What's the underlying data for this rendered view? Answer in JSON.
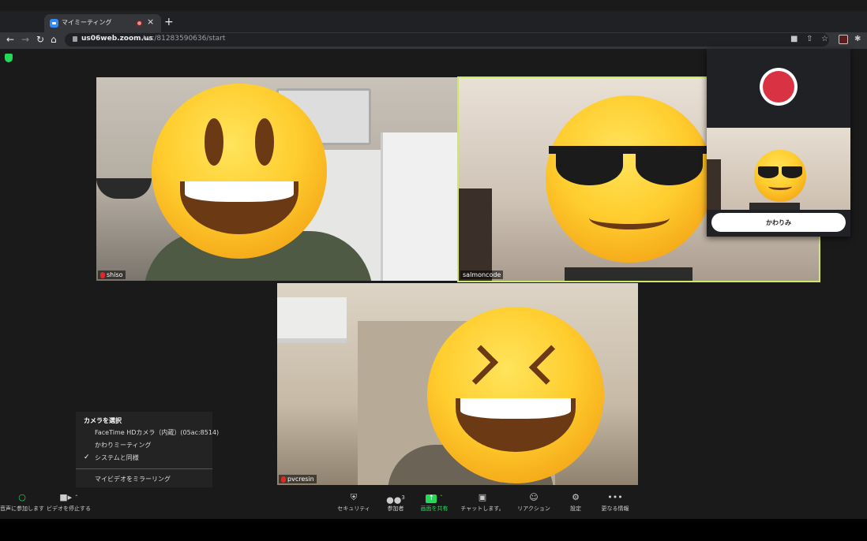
{
  "browser": {
    "tab_title": "マイミーティング",
    "tab_close": "×",
    "new_tab": "+",
    "url_host": "us06web.zoom.us",
    "url_path": "/wc/81283590636/start",
    "icons": [
      "back-icon",
      "forward-icon",
      "reload-icon",
      "home-icon",
      "camera-icon",
      "share-icon",
      "star-icon",
      "extension-icon",
      "puzzle-icon"
    ]
  },
  "participants": [
    {
      "name": "shiso"
    },
    {
      "name": "salmoncode"
    },
    {
      "name": "pvcresin"
    }
  ],
  "popup": {
    "switch_label": "かわりみ"
  },
  "camera_menu": {
    "header": "カメラを選択",
    "options": [
      "FaceTime HDカメラ（内蔵）(05ac:8514)",
      "かわりミーティング",
      "システムと同様"
    ],
    "selected_check": "✓",
    "mirror_label": "マイビデオをミラーリング"
  },
  "toolbar": {
    "audio_label": "音声に参加します",
    "video_label": "ビデオを停止する",
    "security_label": "セキュリティ",
    "participants_label": "参加者",
    "participant_count": "3",
    "share_label": "画面を共有",
    "chat_label": "チャットします。",
    "reaction_label": "リアクション",
    "settings_label": "設定",
    "more_label": "更なる情報"
  },
  "colors": {
    "active_speaker": "#cfe86a",
    "share_green": "#23d959",
    "record_red": "#d93343"
  }
}
